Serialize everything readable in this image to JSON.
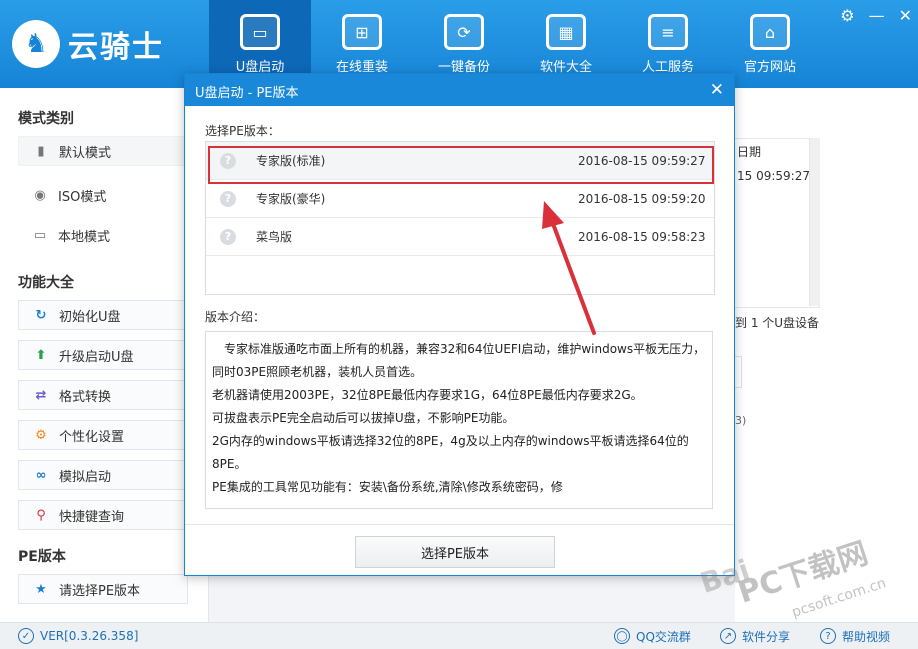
{
  "app": {
    "logo_text": "云骑士",
    "logo_icon": "knight-logo-icon"
  },
  "nav": {
    "tabs": [
      {
        "label": "U盘启动",
        "icon": "usb-icon",
        "active": true
      },
      {
        "label": "在线重装",
        "icon": "windows-icon"
      },
      {
        "label": "一键备份",
        "icon": "backup-icon"
      },
      {
        "label": "软件大全",
        "icon": "software-box-icon"
      },
      {
        "label": "人工服务",
        "icon": "chat-icon"
      },
      {
        "label": "官方网站",
        "icon": "home-icon"
      }
    ]
  },
  "window_controls": {
    "settings": "gear-icon",
    "minimize": "—",
    "close": "✕"
  },
  "sidebar": {
    "mode_title": "模式类别",
    "mode_items": [
      {
        "label": "默认模式",
        "icon": "usb-drive-icon"
      },
      {
        "label": "ISO模式",
        "icon": "disc-icon"
      },
      {
        "label": "本地模式",
        "icon": "monitor-icon"
      }
    ],
    "func_title": "功能大全",
    "func_items": [
      {
        "label": "初始化U盘",
        "icon": "refresh-icon"
      },
      {
        "label": "升级启动U盘",
        "icon": "arrow-up-icon"
      },
      {
        "label": "格式转换",
        "icon": "convert-icon"
      },
      {
        "label": "个性化设置",
        "icon": "gear-icon"
      },
      {
        "label": "模拟启动",
        "icon": "link-icon"
      },
      {
        "label": "快捷键查询",
        "icon": "search-icon"
      }
    ],
    "pe_title": "PE版本",
    "pe_item": {
      "label": "请选择PE版本",
      "icon": "bookmark-icon"
    }
  },
  "background_panel": {
    "col_header": "日期",
    "row_value": "15 09:59:27",
    "status_text": "到 1 个U盘设备",
    "hint_char": "3)"
  },
  "statusbar": {
    "version": "VER[0.3.26.358]",
    "qq": "QQ交流群",
    "share": "软件分享",
    "help": "帮助视频"
  },
  "dialog": {
    "title": "U盘启动 - PE版本",
    "select_label": "选择PE版本：",
    "versions": [
      {
        "name": "专家版(标准)",
        "date": "2016-08-15 09:59:27"
      },
      {
        "name": "专家版(豪华)",
        "date": "2016-08-15 09:59:20"
      },
      {
        "name": "菜鸟版",
        "date": "2016-08-15 09:58:23"
      }
    ],
    "intro_label": "版本介绍：",
    "intro_lines": [
      "　专家标准版通吃市面上所有的机器，兼容32和64位UEFI启动，维护windows平板无压力，同时03PE照顾老机器，装机人员首选。",
      "老机器请使用2003PE，32位8PE最低内存要求1G，64位8PE最低内存要求2G。",
      "可拔盘表示PE完全启动后可以拔掉U盘，不影响PE功能。",
      "2G内存的windows平板请选择32位的8PE，4g及以上内存的windows平板请选择64位的8PE。",
      "PE集成的工具常见功能有：安装\\备份系统,清除\\修改系统密码，修"
    ],
    "choose_button": "选择PE版本",
    "close": "✕"
  },
  "watermark": {
    "text1": "Bai",
    "text2": "PC下载网",
    "text3": "pcsoft.com.cn"
  },
  "colors": {
    "brand": "#1684d6",
    "highlight": "#d9303a"
  }
}
